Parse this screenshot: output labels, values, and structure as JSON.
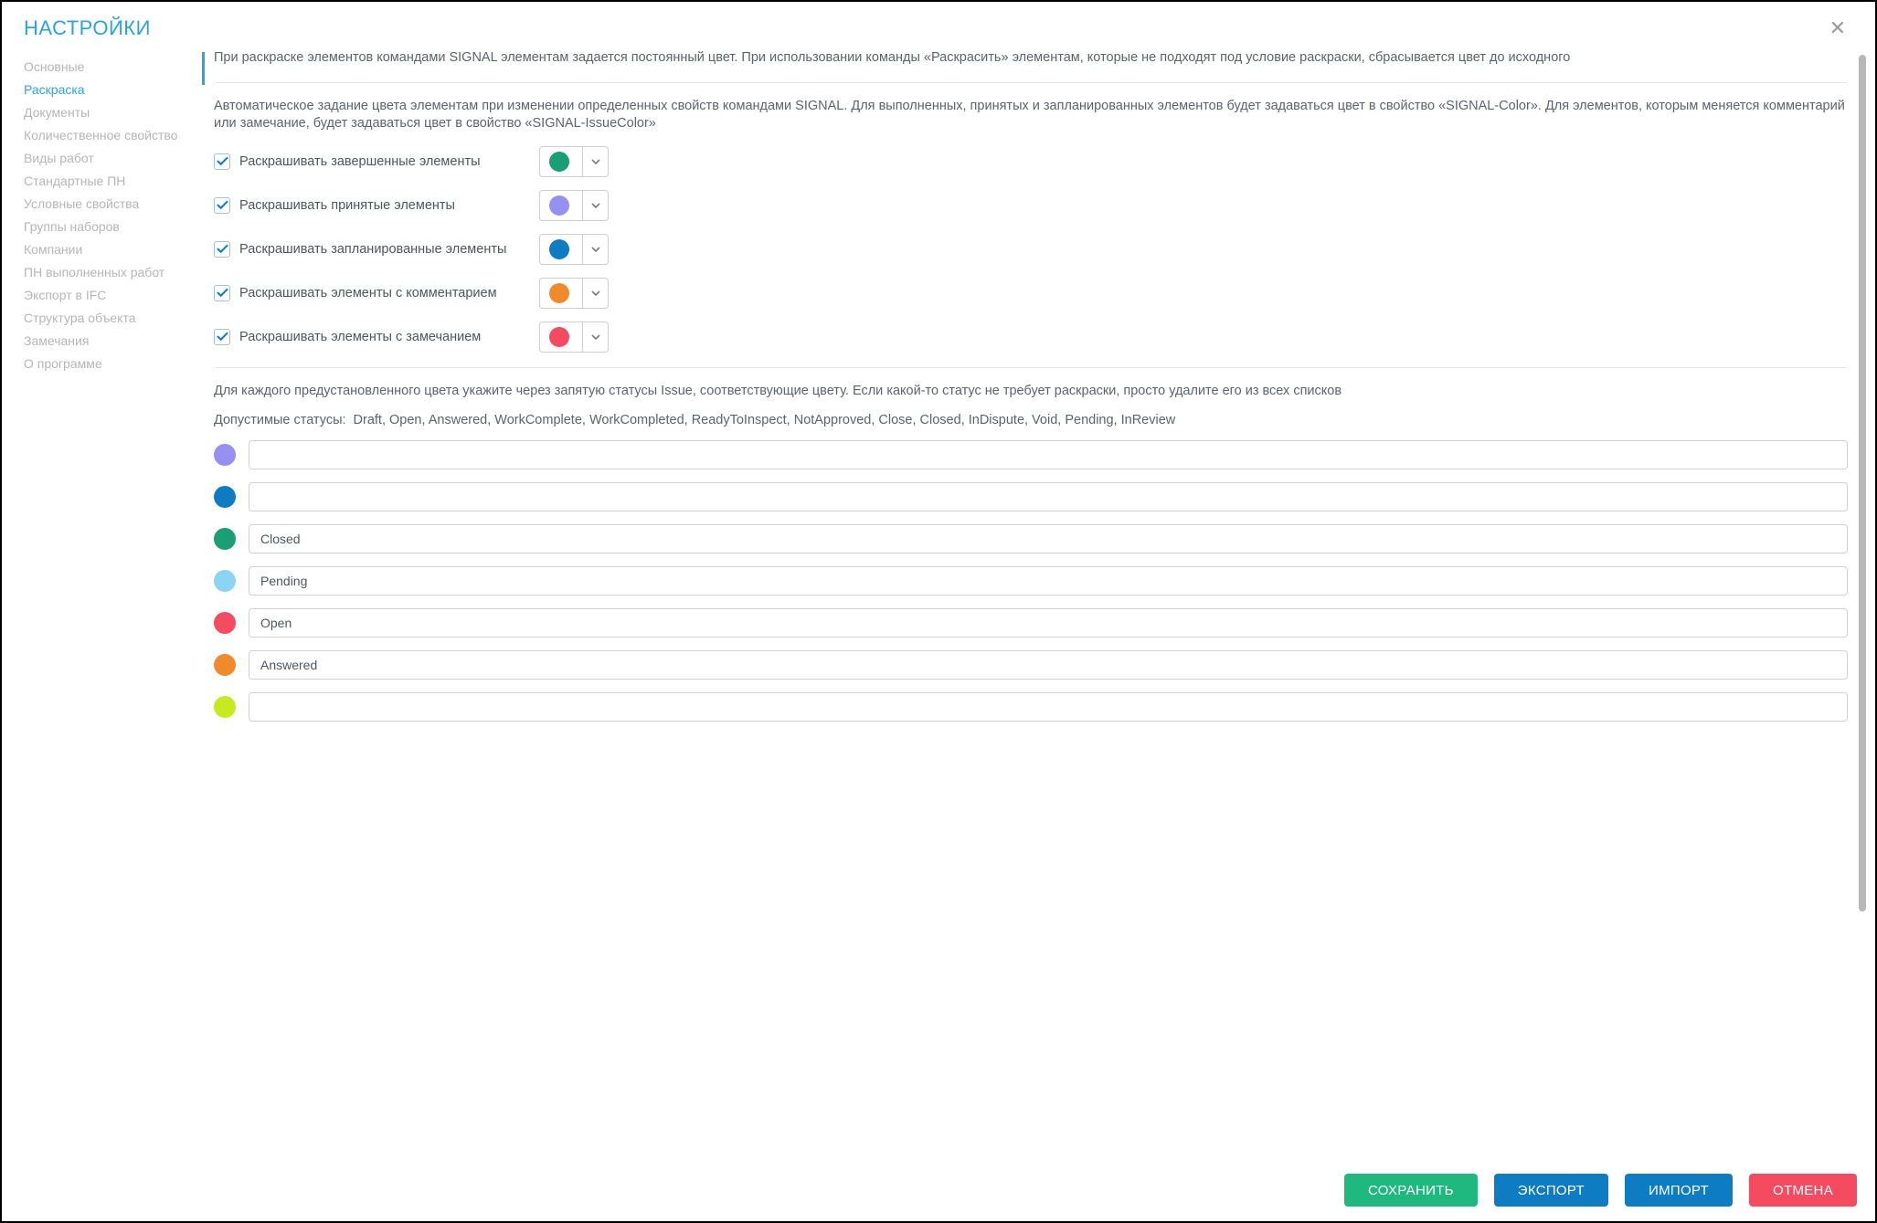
{
  "title": "НАСТРОЙКИ",
  "sidebar": {
    "items": [
      {
        "label": "Основные"
      },
      {
        "label": "Раскраска"
      },
      {
        "label": "Документы"
      },
      {
        "label": "Количественное свойство"
      },
      {
        "label": "Виды работ"
      },
      {
        "label": "Стандартные ПН"
      },
      {
        "label": "Условные свойства"
      },
      {
        "label": "Группы наборов"
      },
      {
        "label": "Компании"
      },
      {
        "label": "ПН выполненных работ"
      },
      {
        "label": "Экспорт в IFC"
      },
      {
        "label": "Структура объекта"
      },
      {
        "label": "Замечания"
      },
      {
        "label": "О программе"
      }
    ],
    "active_index": 1
  },
  "intro_text": "При раскраске элементов командами SIGNAL элементам задается постоянный цвет. При использовании команды «Раскрасить» элементам, которые не подходят под условие раскраски, сбрасывается цвет до исходного",
  "auto_text": "Автоматическое задание цвета элементам при изменении определенных свойств командами SIGNAL. Для выполненных, принятых и запланированных элементов будет задаваться цвет в свойство «SIGNAL-Color». Для элементов, которым меняется комментарий или замечание, будет задаваться цвет в свойство «SIGNAL-IssueColor»",
  "checks": [
    {
      "label": "Раскрашивать завершенные элементы",
      "color": "#1a9e73"
    },
    {
      "label": "Раскрашивать принятые элементы",
      "color": "#9590f2"
    },
    {
      "label": "Раскрашивать запланированные элементы",
      "color": "#0d7cc2"
    },
    {
      "label": "Раскрашивать элементы с комментарием",
      "color": "#f08a2c"
    },
    {
      "label": "Раскрашивать элементы с замечанием",
      "color": "#f44b61"
    }
  ],
  "status_intro": "Для каждого предустановленного цвета укажите через запятую статусы Issue, соответствующие цвету. Если какой-то статус не требует раскраски, просто удалите его из всех списков",
  "statuses_label": "Допустимые статусы:",
  "statuses_list": "Draft, Open, Answered, WorkComplete, WorkCompleted, ReadyToInspect, NotApproved, Close, Closed, InDispute, Void, Pending, InReview",
  "status_rows": [
    {
      "color": "#9590f2",
      "value": ""
    },
    {
      "color": "#0d7cc2",
      "value": ""
    },
    {
      "color": "#1a9e73",
      "value": "Closed"
    },
    {
      "color": "#8ad6f2",
      "value": "Pending"
    },
    {
      "color": "#f44b61",
      "value": "Open"
    },
    {
      "color": "#f08a2c",
      "value": "Answered"
    },
    {
      "color": "#c6ea1f",
      "value": ""
    }
  ],
  "footer": {
    "save": "СОХРАНИТЬ",
    "export": "ЭКСПОРТ",
    "import": "ИМПОРТ",
    "cancel": "ОТМЕНА"
  }
}
